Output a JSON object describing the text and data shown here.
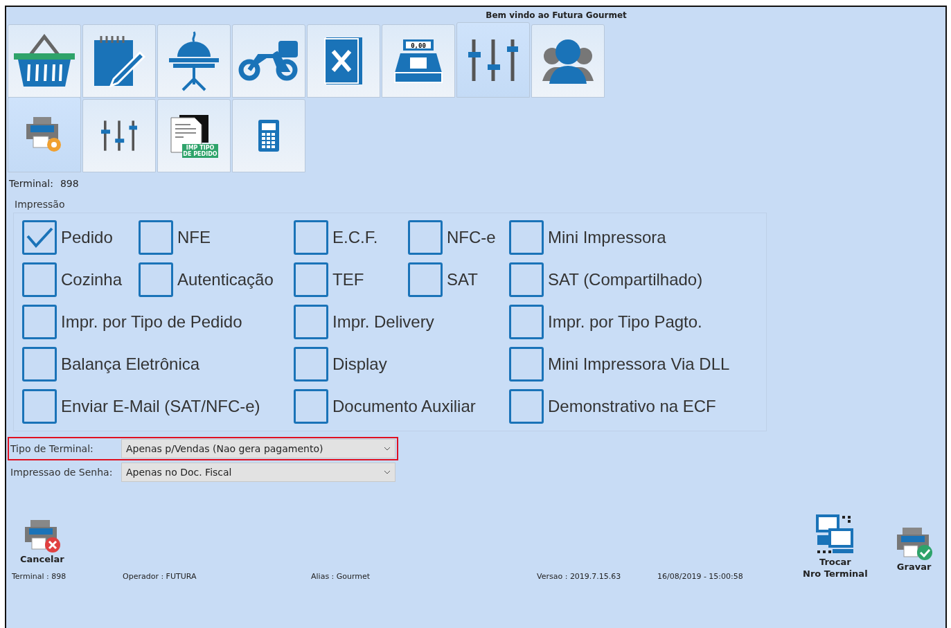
{
  "window": {
    "title": "Bem vindo ao Futura Gourmet"
  },
  "main_tabs": [
    {
      "kind": "basket",
      "selected": false
    },
    {
      "kind": "notepad",
      "selected": false
    },
    {
      "kind": "cloche",
      "selected": false
    },
    {
      "kind": "motorbike",
      "selected": false
    },
    {
      "kind": "menu",
      "selected": false
    },
    {
      "kind": "register",
      "selected": false,
      "badge": "0,00"
    },
    {
      "kind": "sliders",
      "selected": true
    },
    {
      "kind": "users",
      "selected": false
    }
  ],
  "sub_tabs": [
    {
      "kind": "printer",
      "selected": true
    },
    {
      "kind": "sliders",
      "selected": false
    },
    {
      "kind": "document",
      "selected": false,
      "badge": "IMP TIPO DE PEDIDO"
    },
    {
      "kind": "phone",
      "selected": false
    }
  ],
  "terminal": {
    "label": "Terminal:",
    "value": "898"
  },
  "impressao": {
    "title": "Impressão",
    "rows": [
      [
        {
          "label": "Pedido",
          "checked": true
        },
        {
          "label": "NFE",
          "checked": false
        },
        {
          "label": "E.C.F.",
          "checked": false
        },
        {
          "label": "NFC-e",
          "checked": false
        },
        {
          "label": "Mini Impressora",
          "checked": false
        }
      ],
      [
        {
          "label": "Cozinha",
          "checked": false
        },
        {
          "label": "Autenticação",
          "checked": false
        },
        {
          "label": "TEF",
          "checked": false
        },
        {
          "label": "SAT",
          "checked": false
        },
        {
          "label": "SAT (Compartilhado)",
          "checked": false
        }
      ],
      [
        {
          "label": "Impr. por Tipo de Pedido",
          "checked": false
        },
        {
          "label": "Impr. Delivery",
          "checked": false
        },
        {
          "label": "Impr. por Tipo Pagto.",
          "checked": false
        }
      ],
      [
        {
          "label": "Balança Eletrônica",
          "checked": false
        },
        {
          "label": "Display",
          "checked": false
        },
        {
          "label": "Mini Impressora Via DLL",
          "checked": false
        }
      ],
      [
        {
          "label": "Enviar E-Mail (SAT/NFC-e)",
          "checked": false
        },
        {
          "label": "Documento Auxiliar",
          "checked": false
        },
        {
          "label": "Demonstrativo na ECF",
          "checked": false
        }
      ]
    ]
  },
  "selects": [
    {
      "label": "Tipo de Terminal:",
      "value": "Apenas p/Vendas (Nao gera pagamento)",
      "highlighted": true
    },
    {
      "label": "Impressao de Senha:",
      "value": "Apenas no Doc. Fiscal",
      "highlighted": false
    }
  ],
  "cancel_button": {
    "label": "Cancelar"
  },
  "status_bar": [
    {
      "label": "Terminal :",
      "value": "898"
    },
    {
      "label": "Operador :",
      "value": "FUTURA"
    },
    {
      "label": "Alias :",
      "value": "Gourmet"
    },
    {
      "label": "Versao :",
      "value": "2019.7.15.63"
    },
    {
      "value": "16/08/2019 - 15:00:58"
    }
  ],
  "actions": [
    {
      "kind": "switch",
      "lines": [
        "Trocar",
        "Nro Terminal"
      ]
    },
    {
      "kind": "save",
      "lines": [
        "Gravar"
      ]
    }
  ]
}
